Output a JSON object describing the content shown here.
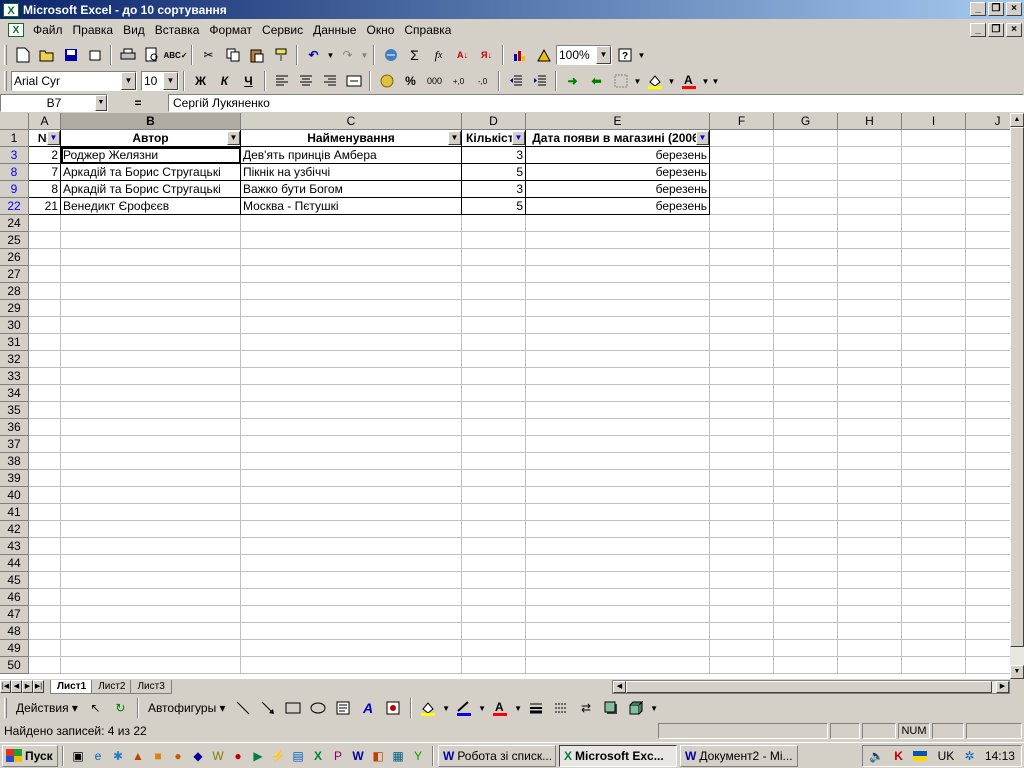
{
  "window": {
    "title": "Microsoft Excel - до 10 сортування",
    "app_icon": "excel-icon"
  },
  "menu": [
    "Файл",
    "Правка",
    "Вид",
    "Вставка",
    "Формат",
    "Сервис",
    "Данные",
    "Окно",
    "Справка"
  ],
  "toolbar": {
    "zoom": "100%"
  },
  "format_toolbar": {
    "font": "Arial Cyr",
    "size": "10",
    "bold": "Ж",
    "italic": "К",
    "underline": "Ч",
    "percent": "%",
    "thousands": "000"
  },
  "formula_bar": {
    "name_box": "B7",
    "equals": "=",
    "value": "Сергій Лукяненко"
  },
  "sheet": {
    "columns": [
      "A",
      "B",
      "C",
      "D",
      "E",
      "F",
      "G",
      "H",
      "I",
      "J"
    ],
    "header_row": {
      "row": "1",
      "cells": [
        "№",
        "Автор",
        "Найменування",
        "Кількість",
        "Дата появи в магазині (2006)"
      ]
    },
    "data_rows": [
      {
        "row": "3",
        "cells": [
          "2",
          "Роджер Желязни",
          "Дев'ять принців Амбера",
          "3",
          "березень"
        ]
      },
      {
        "row": "8",
        "cells": [
          "7",
          "Аркадій та Борис Стругацькі",
          "Пікнік на узбіччі",
          "5",
          "березень"
        ]
      },
      {
        "row": "9",
        "cells": [
          "8",
          "Аркадій та Борис Стругацькі",
          "Важко бути Богом",
          "3",
          "березень"
        ]
      },
      {
        "row": "22",
        "cells": [
          "21",
          "Венедикт Єрофєєв",
          "Москва - Пєтушкі",
          "5",
          "березень"
        ]
      }
    ],
    "empty_rows": [
      "24",
      "25",
      "26",
      "27",
      "28",
      "29",
      "30",
      "31",
      "32",
      "33",
      "34",
      "35",
      "36",
      "37",
      "38",
      "39",
      "40",
      "41",
      "42",
      "43",
      "44",
      "45",
      "46",
      "47",
      "48",
      "49",
      "50"
    ]
  },
  "sheet_tabs": [
    "Лист1",
    "Лист2",
    "Лист3"
  ],
  "draw_toolbar": {
    "actions": "Действия",
    "autoshapes": "Автофигуры"
  },
  "status": {
    "text": "Найдено записей: 4 из 22",
    "num": "NUM"
  },
  "taskbar": {
    "start": "Пуск",
    "buttons": [
      "Робота зі списк...",
      "Microsoft Exc...",
      "Документ2 - Mi..."
    ],
    "lang": "UK",
    "clock": "14:13"
  }
}
